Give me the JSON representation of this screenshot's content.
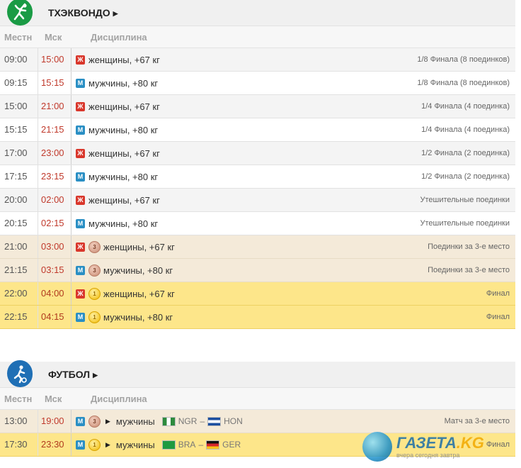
{
  "sections": [
    {
      "title": "ТХЭКВОНДО",
      "icon": "taekwondo-icon",
      "columns": {
        "local": "Местн",
        "msk": "Мск",
        "discipline": "Дисциплина"
      },
      "rows": [
        {
          "local": "09:00",
          "msk": "15:00",
          "gender": "Ж",
          "medal": "",
          "discipline": "женщины, +67 кг",
          "stage": "1/8 Финала (8 поединков)",
          "style": "gray"
        },
        {
          "local": "09:15",
          "msk": "15:15",
          "gender": "М",
          "medal": "",
          "discipline": "мужчины, +80 кг",
          "stage": "1/8 Финала (8 поединков)",
          "style": "white"
        },
        {
          "local": "15:00",
          "msk": "21:00",
          "gender": "Ж",
          "medal": "",
          "discipline": "женщины, +67 кг",
          "stage": "1/4 Финала (4 поединка)",
          "style": "gray"
        },
        {
          "local": "15:15",
          "msk": "21:15",
          "gender": "М",
          "medal": "",
          "discipline": "мужчины, +80 кг",
          "stage": "1/4 Финала (4 поединка)",
          "style": "white"
        },
        {
          "local": "17:00",
          "msk": "23:00",
          "gender": "Ж",
          "medal": "",
          "discipline": "женщины, +67 кг",
          "stage": "1/2 Финала (2 поединка)",
          "style": "gray"
        },
        {
          "local": "17:15",
          "msk": "23:15",
          "gender": "М",
          "medal": "",
          "discipline": "мужчины, +80 кг",
          "stage": "1/2 Финала (2 поединка)",
          "style": "white"
        },
        {
          "local": "20:00",
          "msk": "02:00",
          "gender": "Ж",
          "medal": "",
          "discipline": "женщины, +67 кг",
          "stage": "Утешительные поединки",
          "style": "gray"
        },
        {
          "local": "20:15",
          "msk": "02:15",
          "gender": "М",
          "medal": "",
          "discipline": "мужчины, +80 кг",
          "stage": "Утешительные поединки",
          "style": "white"
        },
        {
          "local": "21:00",
          "msk": "03:00",
          "gender": "Ж",
          "medal": "3",
          "discipline": "женщины, +67 кг",
          "stage": "Поединки за 3-е место",
          "style": "bronze"
        },
        {
          "local": "21:15",
          "msk": "03:15",
          "gender": "М",
          "medal": "3",
          "discipline": "мужчины, +80 кг",
          "stage": "Поединки за 3-е место",
          "style": "bronze"
        },
        {
          "local": "22:00",
          "msk": "04:00",
          "gender": "Ж",
          "medal": "1",
          "discipline": "женщины, +67 кг",
          "stage": "Финал",
          "style": "gold"
        },
        {
          "local": "22:15",
          "msk": "04:15",
          "gender": "М",
          "medal": "1",
          "discipline": "мужчины, +80 кг",
          "stage": "Финал",
          "style": "gold"
        }
      ]
    },
    {
      "title": "ФУТБОЛ",
      "icon": "football-icon",
      "columns": {
        "local": "Местн",
        "msk": "Мск",
        "discipline": "Дисциплина"
      },
      "rows": [
        {
          "local": "13:00",
          "msk": "19:00",
          "gender": "М",
          "medal": "3",
          "discipline": "мужчины",
          "team1": "NGR",
          "team2": "HON",
          "flag1": "ngr",
          "flag2": "hon",
          "stage": "Матч за 3-е место",
          "style": "bronze"
        },
        {
          "local": "17:30",
          "msk": "23:30",
          "gender": "М",
          "medal": "1",
          "discipline": "мужчины",
          "team1": "BRA",
          "team2": "GER",
          "flag1": "bra",
          "flag2": "ger",
          "stage": "Финал",
          "style": "gold"
        }
      ]
    }
  ],
  "watermark": {
    "brand": "ГАЗЕТА",
    "tld": ".KG",
    "tagline": "вчера сегодня завтра"
  },
  "colors": {
    "msk_time": "#c0392b",
    "female_badge": "#d9372c",
    "male_badge": "#2a8fc4",
    "gold_row": "#fde68a",
    "bronze_row": "#f4ead9"
  }
}
